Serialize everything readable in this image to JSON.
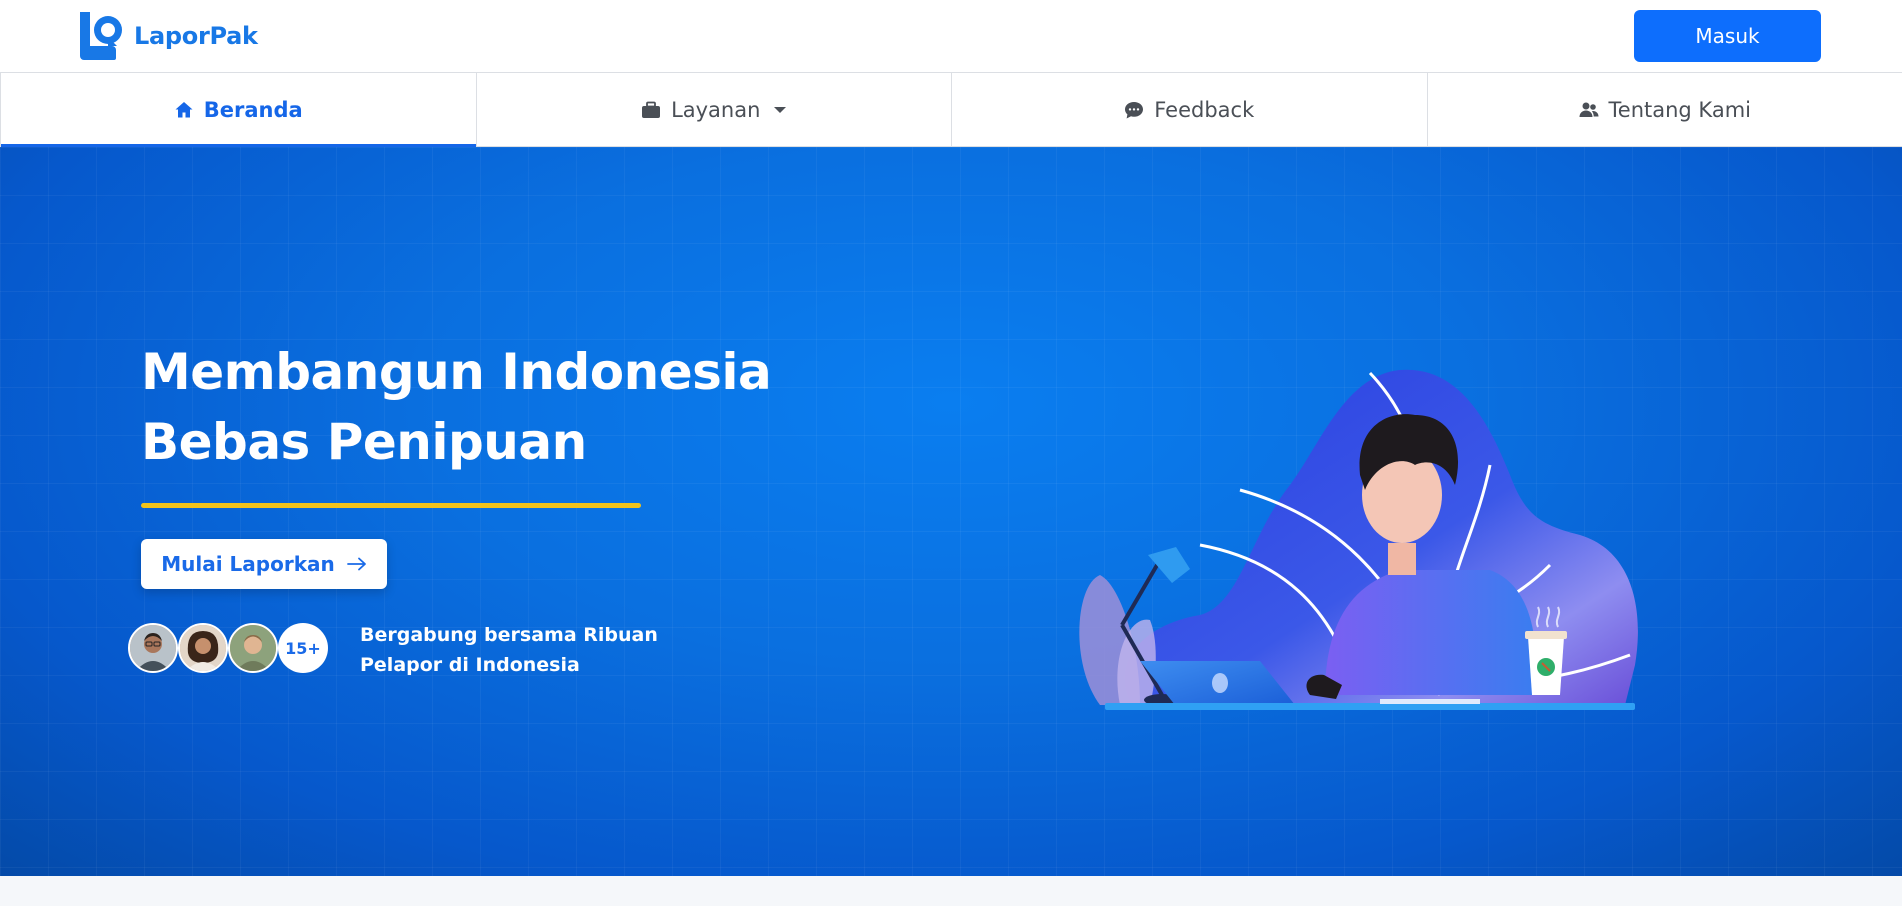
{
  "header": {
    "logo_text": "LaporPak",
    "login_label": "Masuk"
  },
  "nav": {
    "items": [
      {
        "label": "Beranda",
        "icon": "home-icon",
        "active": true
      },
      {
        "label": "Layanan",
        "icon": "briefcase-icon",
        "has_dropdown": true
      },
      {
        "label": "Feedback",
        "icon": "chat-icon"
      },
      {
        "label": "Tentang Kami",
        "icon": "users-icon"
      }
    ]
  },
  "hero": {
    "title_line1": "Membangun Indonesia",
    "title_line2": "Bebas Penipuan",
    "cta_label": "Mulai Laporkan",
    "avatar_count": "15+",
    "join_line1": "Bergabung bersama Ribuan",
    "join_line2": "Pelapor di Indonesia"
  },
  "colors": {
    "brand": "#1878e6",
    "primary_button": "#0d6efd",
    "hero_bg": "#0a6fdf",
    "accent_underline": "#f2c31b",
    "active_nav": "#1566e8"
  }
}
